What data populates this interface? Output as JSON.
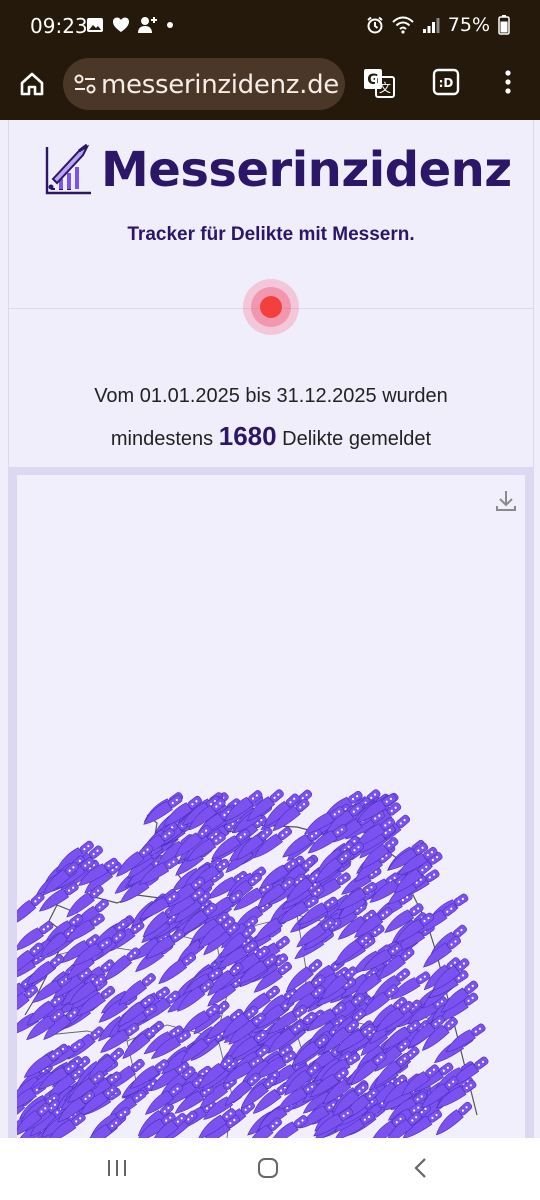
{
  "status_bar": {
    "time": "09:23",
    "battery": "75%"
  },
  "browser": {
    "url": "messerinzidenz.de"
  },
  "header": {
    "title": "Messerinzidenz",
    "tagline": "Tracker für Delikte mit Messern."
  },
  "summary": {
    "prefix": "Vom 01.01.2025 bis 31.12.2025 wurden",
    "middle": "mindestens",
    "count": "1680",
    "suffix": "Delikte gemeldet"
  },
  "colors": {
    "accent": "#2b1668",
    "knife": "#7b52f0",
    "live_dot": "#f43f3f",
    "browser_bar": "#24190a"
  },
  "icons": [
    "home-icon",
    "site-settings-icon",
    "translate-icon",
    "tab-switcher-icon",
    "menu-icon",
    "download-icon",
    "recent-apps-icon",
    "home-button-icon",
    "back-icon"
  ]
}
